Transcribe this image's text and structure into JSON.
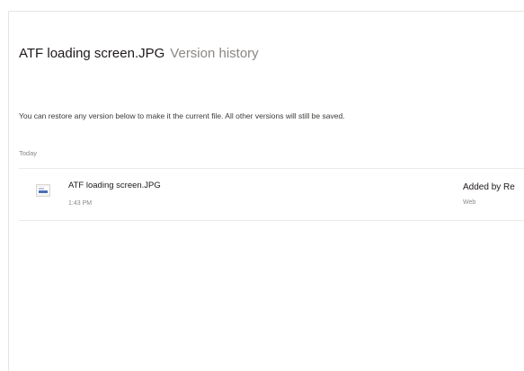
{
  "header": {
    "file_name": "ATF loading screen.JPG",
    "subtitle": "Version history"
  },
  "info_text": "You can restore any version below to make it the current file. All other versions will still be saved.",
  "sections": [
    {
      "label": "Today",
      "versions": [
        {
          "icon": "image-file-icon",
          "name": "ATF loading screen.JPG",
          "time": "1:43 PM",
          "added_by": "Added by Re",
          "source": "Web"
        }
      ]
    }
  ]
}
